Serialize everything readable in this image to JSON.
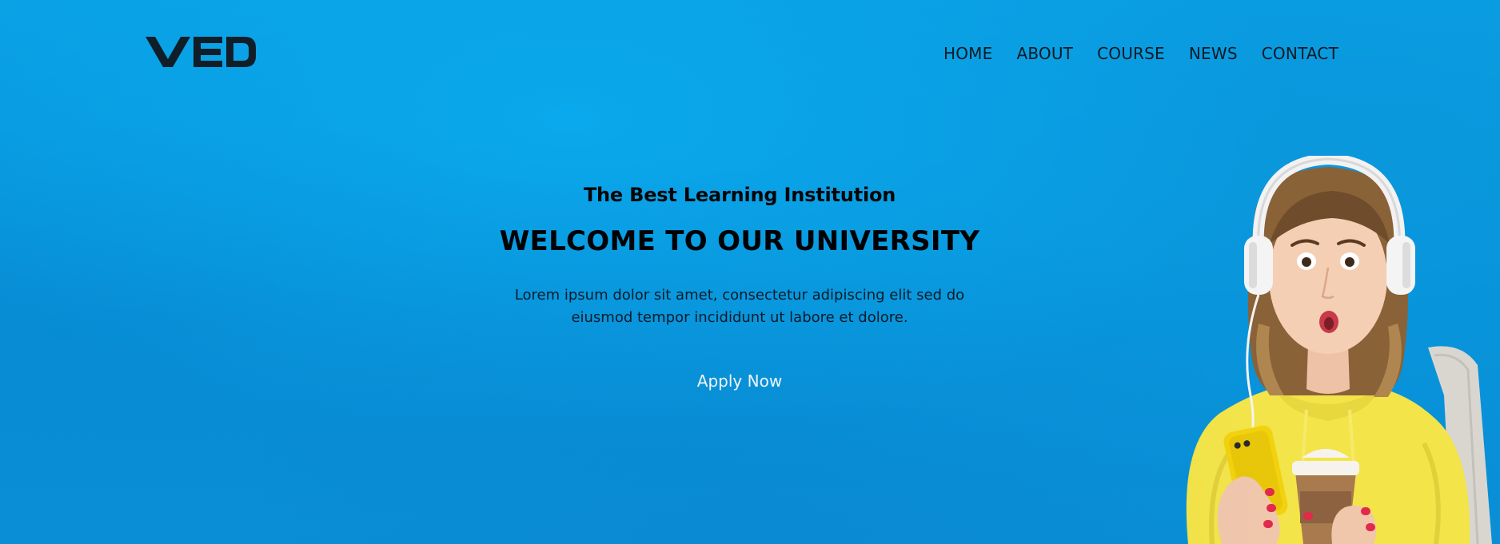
{
  "header": {
    "logo_text": "VED",
    "nav": [
      {
        "label": "HOME"
      },
      {
        "label": "ABOUT"
      },
      {
        "label": "COURSE"
      },
      {
        "label": "NEWS"
      },
      {
        "label": "CONTACT"
      }
    ]
  },
  "hero": {
    "eyebrow": "The Best Learning Institution",
    "headline": "WELCOME TO OUR UNIVERSITY",
    "description": "Lorem ipsum dolor sit amet, consectetur adipiscing elit sed do eiusmod tempor incididunt ut labore et dolore.",
    "cta_label": "Apply Now"
  },
  "colors": {
    "background": "#0a9be0",
    "text_dark": "#000000",
    "cta_text": "#ffffff",
    "hoodie": "#f5e64a"
  },
  "illustration": {
    "subject_icon": "student-with-headphones-image"
  }
}
